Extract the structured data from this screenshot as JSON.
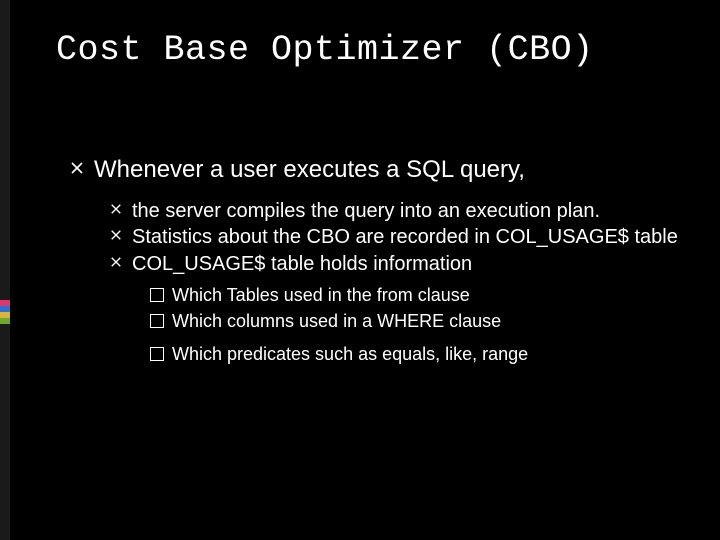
{
  "title": "Cost Base Optimizer (CBO)",
  "level1": "Whenever a user executes a SQL query,",
  "level2": [
    "the server  compiles the query into an execution plan.",
    "Statistics about the CBO are recorded in COL_USAGE$  table",
    "COL_USAGE$ table holds information"
  ],
  "level3": [
    "Which Tables used  in the from clause",
    "Which  columns used in a WHERE clause",
    "Which  predicates such as equals, like, range"
  ],
  "rail_colors": [
    "#d9376e",
    "#2e6fd1",
    "#d9b43a",
    "#6ea62e"
  ],
  "icons": {
    "x_bullet": "x-bullet-icon",
    "box_bullet": "square-bullet-icon"
  }
}
